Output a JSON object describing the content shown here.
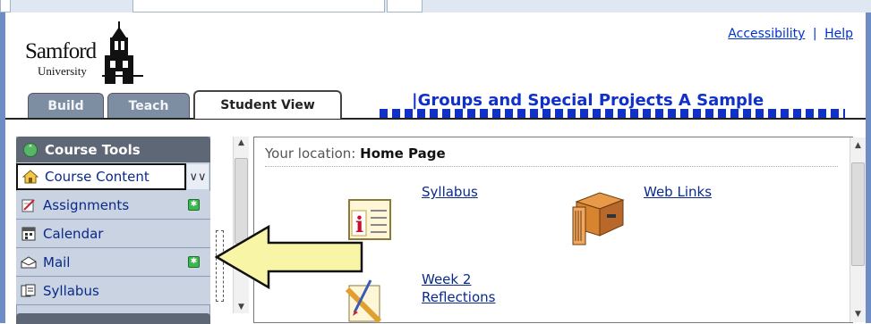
{
  "header": {
    "logo_name": "Samford",
    "logo_sub": "University",
    "accessibility": "Accessibility",
    "separator": "|",
    "help": "Help"
  },
  "tabs": [
    {
      "label": "Build"
    },
    {
      "label": "Teach"
    },
    {
      "label": "Student View"
    }
  ],
  "course_title": "|Groups and Special Projects A Sample",
  "tools": {
    "header": "Course Tools",
    "items": [
      {
        "label": "Course Content",
        "icon": "home-icon",
        "selected": true
      },
      {
        "label": "Assignments",
        "icon": "assignment-icon",
        "new": true
      },
      {
        "label": "Calendar",
        "icon": "calendar-icon"
      },
      {
        "label": "Mail",
        "icon": "mail-icon",
        "new": true
      },
      {
        "label": "Syllabus",
        "icon": "syllabus-icon"
      }
    ]
  },
  "content": {
    "location_prefix": "Your location:",
    "location": "Home Page",
    "links": [
      {
        "label": "Syllabus",
        "icon": "syllabus-doc-icon"
      },
      {
        "label": "Web Links",
        "icon": "filing-cabinet-icon"
      },
      {
        "label": "Week 2",
        "label2": "Reflections",
        "icon": "pencil-ruler-icon"
      }
    ]
  },
  "colors": {
    "accent_blue": "#1030c8",
    "link": "#0a2a8a",
    "tool_bg": "#c9d3e2",
    "arrow_fill": "#f8f5a6"
  }
}
